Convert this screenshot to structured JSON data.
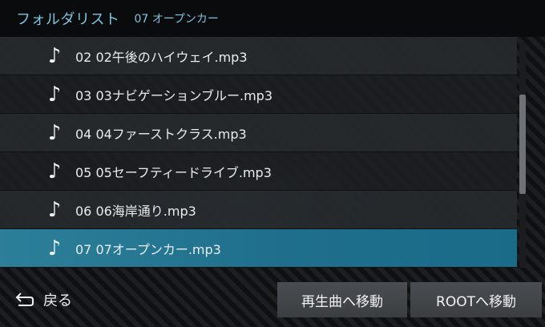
{
  "header": {
    "title": "フォルダリスト",
    "current_folder": "07 オープンカー"
  },
  "list": {
    "items": [
      {
        "label": "02 02午後のハイウェイ.mp3",
        "icon": "music-note-icon",
        "selected": false
      },
      {
        "label": "03 03ナビゲーションブルー.mp3",
        "icon": "music-note-icon",
        "selected": false
      },
      {
        "label": "04 04ファーストクラス.mp3",
        "icon": "music-note-icon",
        "selected": false
      },
      {
        "label": "05 05セーフティードライブ.mp3",
        "icon": "music-note-icon",
        "selected": false
      },
      {
        "label": "06 06海岸通り.mp3",
        "icon": "music-note-icon",
        "selected": false
      },
      {
        "label": "07 07オープンカー.mp3",
        "icon": "music-note-icon",
        "selected": true
      }
    ],
    "note_glyph": "♪"
  },
  "footer": {
    "back_label": "戻る",
    "play_move_label": "再生曲へ移動",
    "root_move_label": "ROOTへ移動"
  },
  "colors": {
    "accent": "#7fc4e0",
    "selected_row": "#1f6f8c",
    "button_bg": "#45494c"
  }
}
